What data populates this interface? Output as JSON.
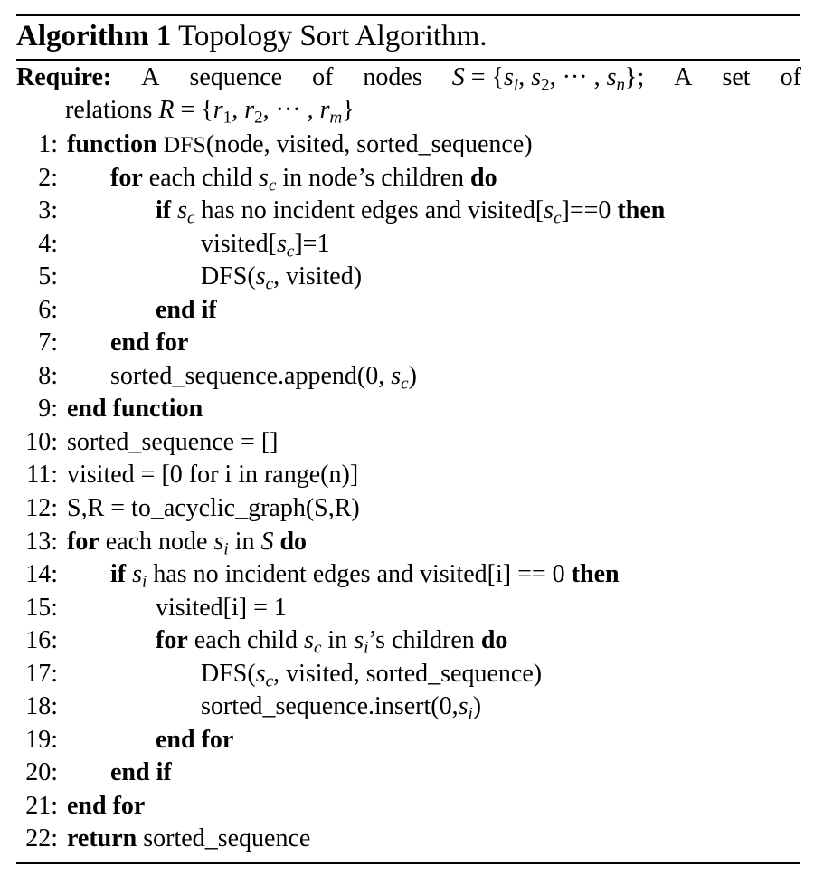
{
  "caption": {
    "label": "Algorithm 1",
    "title": "Topology Sort Algorithm."
  },
  "require": {
    "keyword": "Require:",
    "line1_parts": [
      "A",
      "sequence",
      "of",
      "nodes",
      "S = {s_i, s_2, ··· , s_n};",
      "A",
      "set",
      "of"
    ],
    "line2": "relations R = {r_1, r_2, ··· , r_m}"
  },
  "lines": [
    {
      "num": "1:",
      "indent": 0,
      "text": "function DFS(node, visited, sorted_sequence)"
    },
    {
      "num": "2:",
      "indent": 1,
      "text": "for each child s_c in node’s children do"
    },
    {
      "num": "3:",
      "indent": 2,
      "text": "if s_c has no incident edges and visited[s_c]==0 then"
    },
    {
      "num": "4:",
      "indent": 3,
      "text": "visited[s_c]=1"
    },
    {
      "num": "5:",
      "indent": 3,
      "text": "DFS(s_c, visited)"
    },
    {
      "num": "6:",
      "indent": 2,
      "text": "end if"
    },
    {
      "num": "7:",
      "indent": 1,
      "text": "end for"
    },
    {
      "num": "8:",
      "indent": 1,
      "text": "sorted_sequence.append(0, s_c)"
    },
    {
      "num": "9:",
      "indent": 0,
      "text": "end function"
    },
    {
      "num": "10:",
      "indent": 0,
      "text": "sorted_sequence = []"
    },
    {
      "num": "11:",
      "indent": 0,
      "text": "visited = [0 for i in range(n)]"
    },
    {
      "num": "12:",
      "indent": 0,
      "text": "S,R = to_acyclic_graph(S,R)"
    },
    {
      "num": "13:",
      "indent": 0,
      "text": "for each node s_i in S do"
    },
    {
      "num": "14:",
      "indent": 1,
      "text": "if s_i has no incident edges and visited[i] == 0 then"
    },
    {
      "num": "15:",
      "indent": 2,
      "text": "visited[i] = 1"
    },
    {
      "num": "16:",
      "indent": 2,
      "text": "for each child s_c in s_i’s children do"
    },
    {
      "num": "17:",
      "indent": 3,
      "text": "DFS(s_c, visited, sorted_sequence)"
    },
    {
      "num": "18:",
      "indent": 3,
      "text": "sorted_sequence.insert(0,s_i)"
    },
    {
      "num": "19:",
      "indent": 2,
      "text": "end for"
    },
    {
      "num": "20:",
      "indent": 1,
      "text": "end if"
    },
    {
      "num": "21:",
      "indent": 0,
      "text": "end for"
    },
    {
      "num": "22:",
      "indent": 0,
      "text": "return sorted_sequence"
    }
  ]
}
